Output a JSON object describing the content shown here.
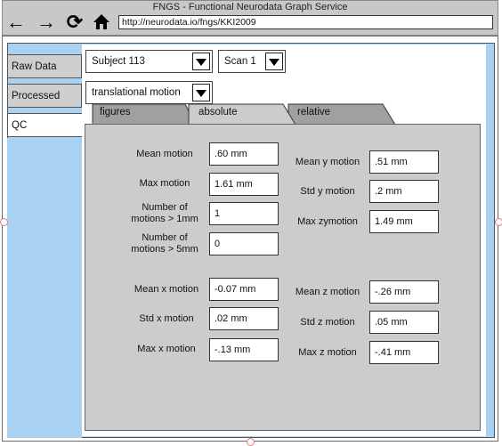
{
  "window": {
    "title": "FNGS - Functional Neurodata Graph Service"
  },
  "browser": {
    "url": "http://neurodata.io/fngs/KKI2009"
  },
  "nav": {
    "raw": "Raw Data",
    "processed": "Processed",
    "qc": "QC"
  },
  "selectors": {
    "subject": "Subject 113",
    "scan": "Scan 1",
    "motion": "translational motion"
  },
  "tabs": {
    "figures": "figures",
    "absolute": "absolute",
    "relative": "relative"
  },
  "metrics": {
    "mean_motion": {
      "label": "Mean motion",
      "value": ".60 mm"
    },
    "max_motion": {
      "label": "Max motion",
      "value": "1.61 mm"
    },
    "motions_gt_1mm": {
      "label": "Number of\nmotions > 1mm",
      "value": "1"
    },
    "motions_gt_5mm": {
      "label": "Number of\nmotions > 5mm",
      "value": "0"
    },
    "mean_y": {
      "label": "Mean y motion",
      "value": ".51 mm"
    },
    "std_y": {
      "label": "Std y motion",
      "value": ".2 mm"
    },
    "max_y": {
      "label": "Max zymotion",
      "value": "1.49 mm"
    },
    "mean_x": {
      "label": "Mean x motion",
      "value": "-0.07 mm"
    },
    "std_x": {
      "label": "Std x motion",
      "value": ".02 mm"
    },
    "max_x": {
      "label": "Max x motion",
      "value": "-.13 mm"
    },
    "mean_z": {
      "label": "Mean z motion",
      "value": "-.26 mm"
    },
    "std_z": {
      "label": "Std z motion",
      "value": ".05 mm"
    },
    "max_z": {
      "label": "Max z motion",
      "value": "-.41 mm"
    }
  }
}
